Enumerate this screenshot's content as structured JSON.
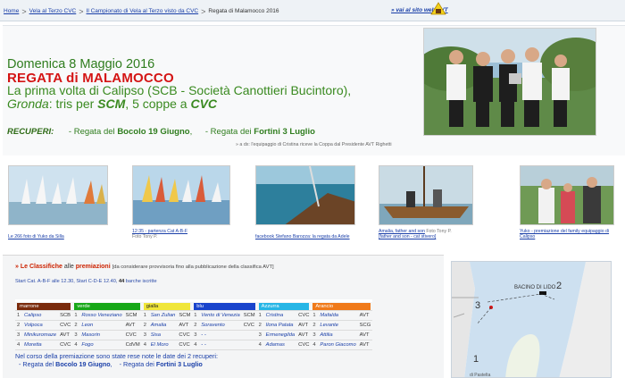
{
  "breadcrumb": {
    "home": "Home",
    "item2": "Vela al Terzo CVC",
    "item3": "Il Campionato di Vela al Terzo visto da CVC",
    "current": "Regata di Malamocco 2016",
    "sep": ">",
    "site_link": "» vai al sito web AVT"
  },
  "hero": {
    "date": "Domenica 8 Maggio 2016",
    "title": "REGATA di MALAMOCCO",
    "subtitle1": "La prima volta di Calipso (SCB - Società Canottieri Bucintoro),",
    "subtitle2_a": "Gronda",
    "subtitle2_b": ": tris per ",
    "subtitle2_c": "SCM",
    "subtitle2_d": ", 5 coppe a ",
    "subtitle2_e": "CVC",
    "recuperi_label": "RECUPERI:",
    "rec1_a": "- Regata del ",
    "rec1_b": "Bocolo 19 Giugno",
    "rec1_c": ",",
    "rec2_a": "- Regata dei ",
    "rec2_b": "Fortini 3 Luglio",
    "photo_caption": "» a dx: l'equipaggio di Cristina riceve la Coppa dal Presidente AVT Righetti"
  },
  "thumbs": [
    {
      "link": "Le 266 foto di Yuko da Silla",
      "extra": ""
    },
    {
      "link": "12:35 - partenza Cat A-B-F",
      "extra": "Foto Tony P."
    },
    {
      "link": "facebook Stefano Barozza: la regata da Adele",
      "extra": ""
    },
    {
      "link": "Amalia, father and son",
      "extra": "Foto Tony P.",
      "extra2": "[father and son - cat stivero]"
    },
    {
      "link": "Yuko - premiazione del family equipaggio di Calipso",
      "extra": ""
    }
  ],
  "classifiche": {
    "marker": "»",
    "title_red": "Le Classifiche",
    "alle": "alle",
    "premiazioni": "premiazioni",
    "note": "[da considerare provvisoria fino alla pubblicazione della classifica AVT]",
    "start_a": "Start Cat. A-B-F alle 12.30, Start C-D-E 12.40,",
    "start_count": "44",
    "start_b": "barche iscritte",
    "categories": [
      {
        "name": "marrone",
        "color": "#7a2b0c",
        "rows": [
          [
            "1",
            "Calipso",
            "SCB"
          ],
          [
            "2",
            "Volpoca",
            "CVC"
          ],
          [
            "3",
            "Minikuromaze",
            "AVT"
          ],
          [
            "4",
            "Moretta",
            "CVC"
          ]
        ]
      },
      {
        "name": "verde",
        "color": "#18a818",
        "rows": [
          [
            "1",
            "Rosso Veneziano",
            "SCM"
          ],
          [
            "2",
            "Leon",
            "AVT"
          ],
          [
            "3",
            "Masorin",
            "CVC"
          ],
          [
            "4",
            "Fogo",
            "CdVM"
          ]
        ]
      },
      {
        "name": "gialla",
        "color": "#f0e63a",
        "rows": [
          [
            "1",
            "San Zulian",
            "SCM"
          ],
          [
            "2",
            "Amalia",
            "AVT"
          ],
          [
            "3",
            "Sisa",
            "CVC"
          ],
          [
            "4",
            "El Moro",
            "CVC"
          ]
        ]
      },
      {
        "name": "blu",
        "color": "#1a44cc",
        "rows": [
          [
            "1",
            "Vento di Venezia",
            "SCM"
          ],
          [
            "2",
            "Soravento",
            "CVC"
          ],
          [
            "3",
            "- -",
            ""
          ],
          [
            "4",
            "- -",
            ""
          ]
        ]
      },
      {
        "name": "Azzurra",
        "color": "#27b6e6",
        "rows": [
          [
            "1",
            "Cristina",
            "CVC"
          ],
          [
            "2",
            "Ilona Patata",
            "AVT"
          ],
          [
            "3",
            "Ermenegilda",
            "AVT"
          ],
          [
            "4",
            "Adamas",
            "CVC"
          ]
        ]
      },
      {
        "name": "Arancio",
        "color": "#f07a1a",
        "rows": [
          [
            "1",
            "Mafalda",
            "AVT"
          ],
          [
            "2",
            "Levante",
            "SCG"
          ],
          [
            "3",
            "Attilia",
            "AVT"
          ],
          [
            "4",
            "Paron Giacomo",
            "AVT"
          ]
        ]
      }
    ],
    "footer1": "Nel corso della premiazione sono state rese note le date dei 2 recuperi:",
    "footer2_a": "- Regata del ",
    "footer2_b": "Bocolo 19 Giugno",
    "footer2_c": ",",
    "footer2_d": "- Regata dei ",
    "footer2_e": "Fortini 3 Luglio"
  },
  "map": {
    "label1": "BACINO DI LIDO",
    "num2": "2",
    "num3": "3",
    "num1": "1",
    "bottom": "di Pastelta"
  },
  "colors": {
    "accent_green": "#2f7d1e",
    "title_red": "#d41414",
    "link_blue": "#1a3fa8"
  }
}
